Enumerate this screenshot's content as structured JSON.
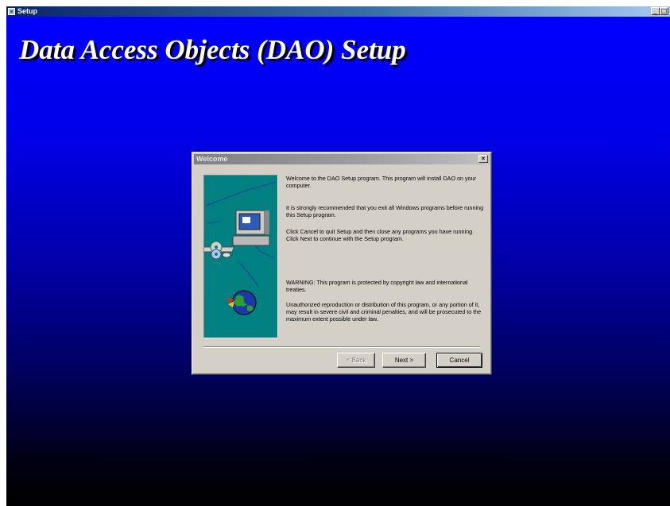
{
  "window": {
    "title": "Setup",
    "minimize_glyph": "_",
    "restore_glyph": "□",
    "close_glyph": "×"
  },
  "heading": "Data Access Objects (DAO) Setup",
  "dialog": {
    "title": "Welcome",
    "close_glyph": "×",
    "paragraphs": [
      "Welcome to the DAO Setup program.  This program will install DAO on your computer.",
      "It is strongly recommended that you exit all Windows programs before running this Setup program.",
      "Click Cancel to quit Setup and then close any programs you have running.  Click Next to continue with the Setup program.",
      "WARNING: This program is protected by copyright law and international treaties.",
      "Unauthorized reproduction or distribution of this program, or any portion of it, may result in severe civil and criminal penalties, and will be prosecuted to the maximum extent possible under law."
    ],
    "buttons": {
      "back": "< Back",
      "next": "Next >",
      "cancel": "Cancel"
    },
    "back_enabled": false
  },
  "colors": {
    "desktop_top": "#0000ff",
    "desktop_bottom": "#000000",
    "side_panel": "#008080",
    "dialog_face": "#d4d0c8"
  },
  "icons": [
    "setup-app-icon",
    "computer-network-graphic",
    "cd-disc-icon",
    "globe-icon"
  ]
}
